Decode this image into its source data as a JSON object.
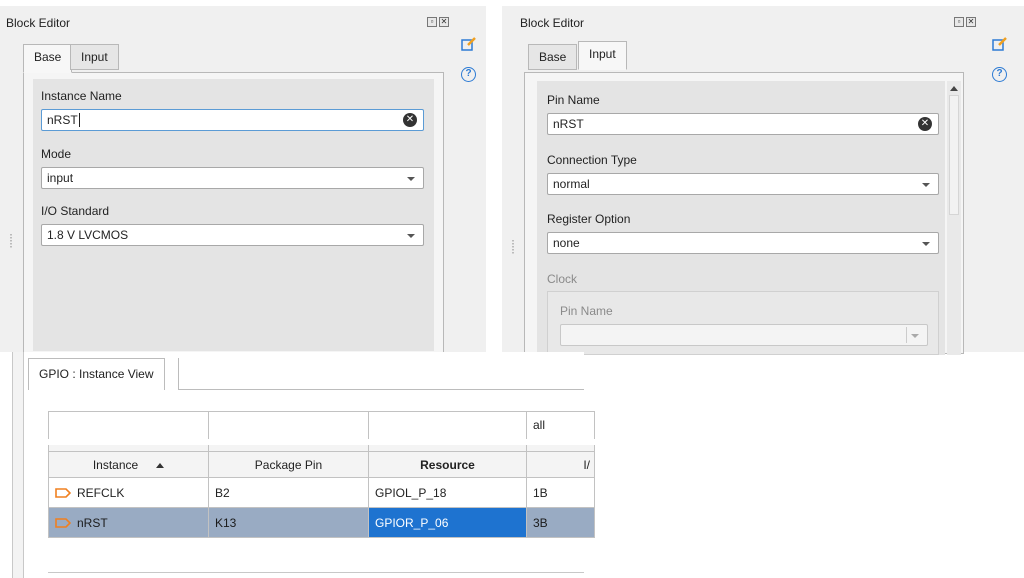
{
  "left_editor": {
    "title": "Block Editor",
    "tabs": [
      {
        "label": "Base"
      },
      {
        "label": "Input"
      }
    ],
    "active_tab": "Base",
    "fields": {
      "instance_name": {
        "label": "Instance Name",
        "value": "nRST"
      },
      "mode": {
        "label": "Mode",
        "value": "input"
      },
      "io_standard": {
        "label": "I/O Standard",
        "value": "1.8 V LVCMOS"
      }
    }
  },
  "right_editor": {
    "title": "Block Editor",
    "tabs": [
      {
        "label": "Base"
      },
      {
        "label": "Input"
      }
    ],
    "active_tab": "Input",
    "fields": {
      "pin_name": {
        "label": "Pin Name",
        "value": "nRST"
      },
      "connection_type": {
        "label": "Connection Type",
        "value": "normal"
      },
      "register_option": {
        "label": "Register Option",
        "value": "none"
      },
      "clock": {
        "label": "Clock"
      },
      "clock_pin_name": {
        "label": "Pin Name",
        "value": ""
      }
    }
  },
  "instance_view": {
    "tab_label": "GPIO : Instance View",
    "filter_row": [
      "",
      "",
      "",
      "all"
    ],
    "columns": [
      "Instance",
      "Package Pin",
      "Resource",
      "I/"
    ],
    "sort_column": "Instance",
    "rows": [
      {
        "instance": "REFCLK",
        "package_pin": "B2",
        "resource": "GPIOL_P_18",
        "bank": "1B",
        "selected": false
      },
      {
        "instance": "nRST",
        "package_pin": "K13",
        "resource": "GPIOR_P_06",
        "bank": "3B",
        "selected": true
      }
    ]
  },
  "icons": {
    "window_buttons": [
      "restore-icon",
      "close-icon"
    ],
    "side_tools": [
      "edit-icon",
      "help-icon"
    ],
    "clear": "clear-text-icon",
    "dropdown": "chevron-down-icon",
    "instance_marker": "pin-arrow-icon"
  },
  "colors": {
    "selected_row": "#99abc3",
    "focused_cell": "#1e73d0",
    "help_blue": "#2d7bd4",
    "edit_orange": "#f0a020"
  }
}
